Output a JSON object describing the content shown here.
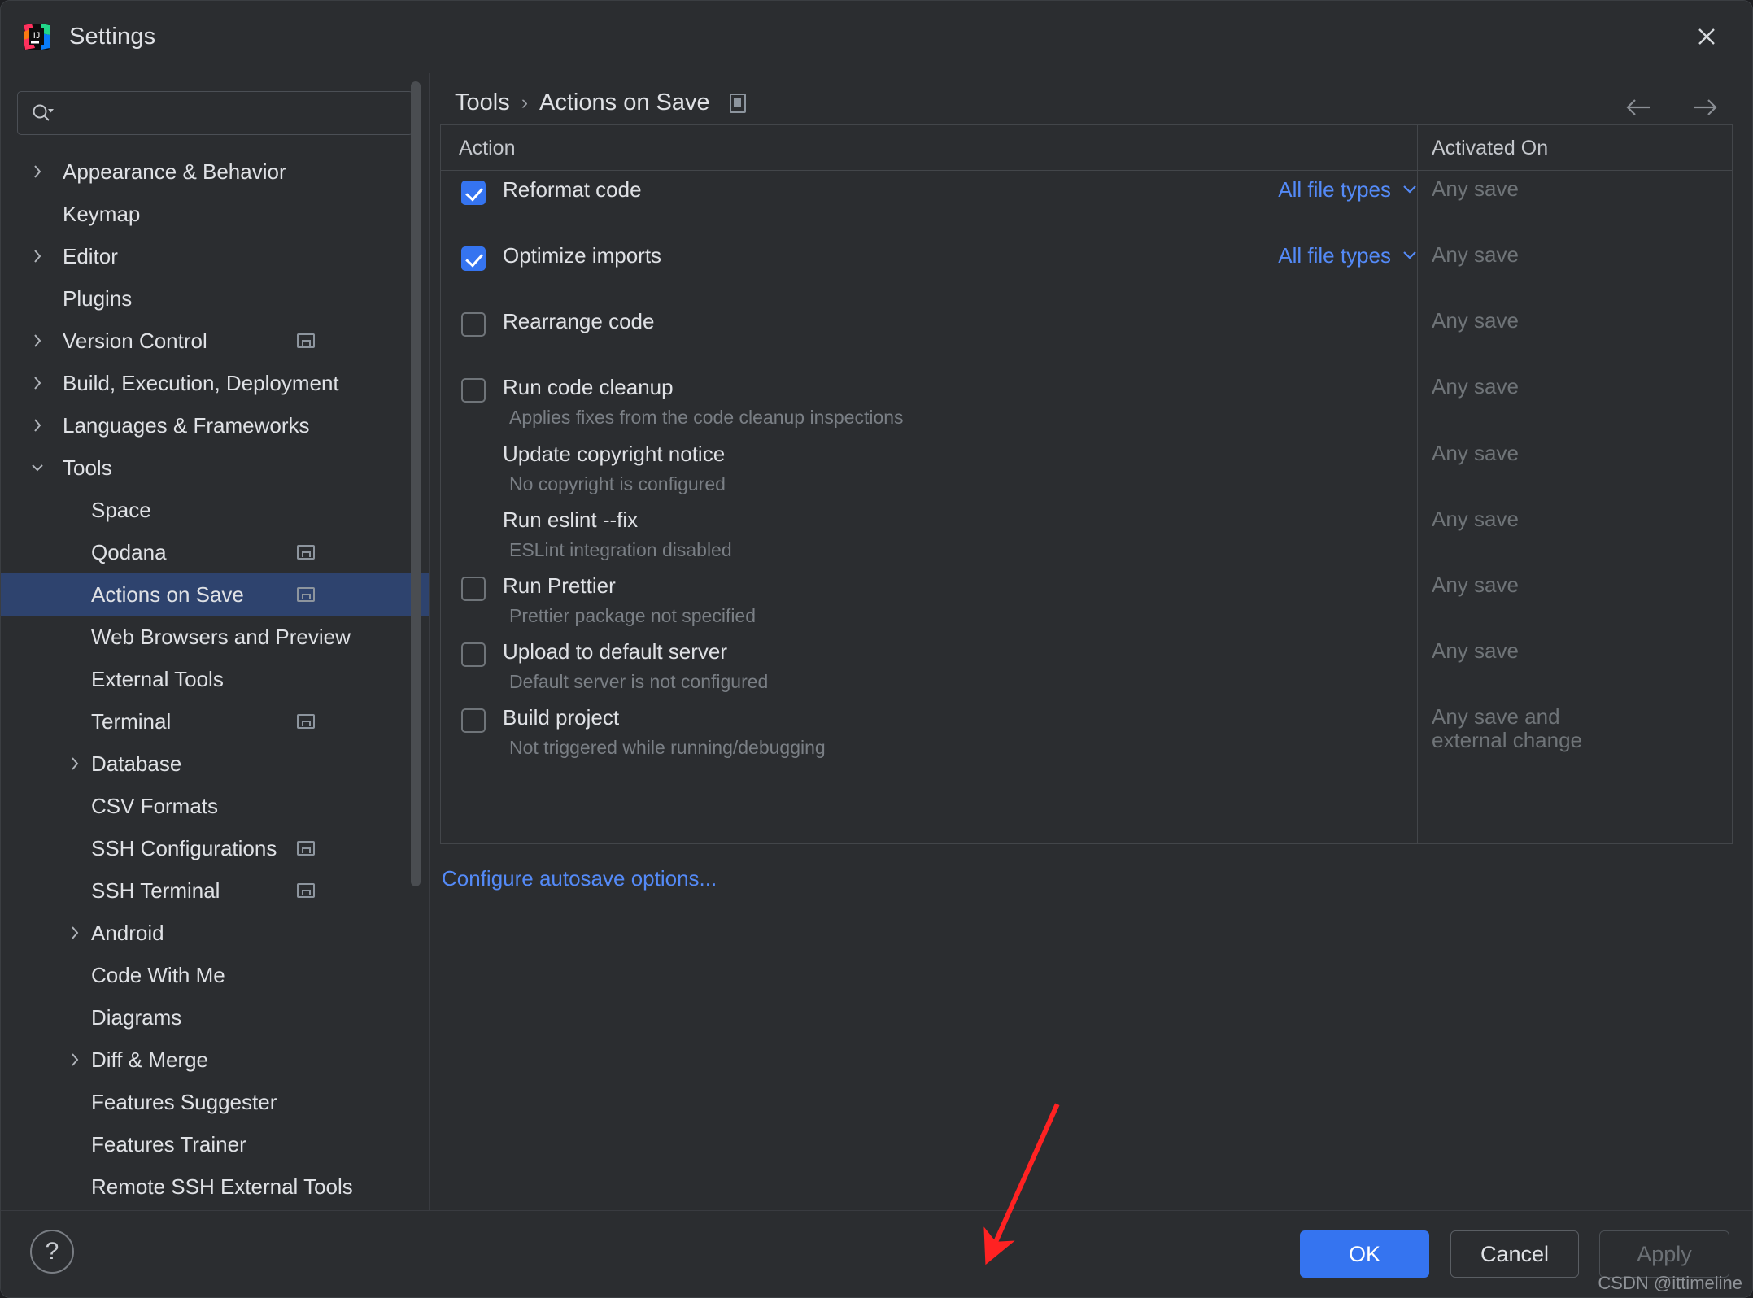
{
  "window": {
    "title": "Settings",
    "app_icon": "intellij-idea-icon",
    "close_icon": "close-icon"
  },
  "sidebar": {
    "search": {
      "placeholder": "",
      "value": "",
      "icon": "search-icon"
    },
    "items": [
      {
        "label": "Appearance & Behavior",
        "depth": 0,
        "twisty": "chevron-right",
        "config": false,
        "selected": false
      },
      {
        "label": "Keymap",
        "depth": 0,
        "twisty": "",
        "config": false,
        "selected": false
      },
      {
        "label": "Editor",
        "depth": 0,
        "twisty": "chevron-right",
        "config": false,
        "selected": false
      },
      {
        "label": "Plugins",
        "depth": 0,
        "twisty": "",
        "config": false,
        "selected": false
      },
      {
        "label": "Version Control",
        "depth": 0,
        "twisty": "chevron-right",
        "config": true,
        "selected": false
      },
      {
        "label": "Build, Execution, Deployment",
        "depth": 0,
        "twisty": "chevron-right",
        "config": false,
        "selected": false
      },
      {
        "label": "Languages & Frameworks",
        "depth": 0,
        "twisty": "chevron-right",
        "config": false,
        "selected": false
      },
      {
        "label": "Tools",
        "depth": 0,
        "twisty": "chevron-down",
        "config": false,
        "selected": false
      },
      {
        "label": "Space",
        "depth": 1,
        "twisty": "",
        "config": false,
        "selected": false
      },
      {
        "label": "Qodana",
        "depth": 1,
        "twisty": "",
        "config": true,
        "selected": false
      },
      {
        "label": "Actions on Save",
        "depth": 1,
        "twisty": "",
        "config": true,
        "selected": true
      },
      {
        "label": "Web Browsers and Preview",
        "depth": 1,
        "twisty": "",
        "config": false,
        "selected": false
      },
      {
        "label": "External Tools",
        "depth": 1,
        "twisty": "",
        "config": false,
        "selected": false
      },
      {
        "label": "Terminal",
        "depth": 1,
        "twisty": "",
        "config": true,
        "selected": false
      },
      {
        "label": "Database",
        "depth": 1,
        "twisty": "chevron-right",
        "config": false,
        "selected": false
      },
      {
        "label": "CSV Formats",
        "depth": 1,
        "twisty": "",
        "config": false,
        "selected": false
      },
      {
        "label": "SSH Configurations",
        "depth": 1,
        "twisty": "",
        "config": true,
        "selected": false
      },
      {
        "label": "SSH Terminal",
        "depth": 1,
        "twisty": "",
        "config": true,
        "selected": false
      },
      {
        "label": "Android",
        "depth": 1,
        "twisty": "chevron-right",
        "config": false,
        "selected": false
      },
      {
        "label": "Code With Me",
        "depth": 1,
        "twisty": "",
        "config": false,
        "selected": false
      },
      {
        "label": "Diagrams",
        "depth": 1,
        "twisty": "",
        "config": false,
        "selected": false
      },
      {
        "label": "Diff & Merge",
        "depth": 1,
        "twisty": "chevron-right",
        "config": false,
        "selected": false
      },
      {
        "label": "Features Suggester",
        "depth": 1,
        "twisty": "",
        "config": false,
        "selected": false
      },
      {
        "label": "Features Trainer",
        "depth": 1,
        "twisty": "",
        "config": false,
        "selected": false
      },
      {
        "label": "Remote SSH External Tools",
        "depth": 1,
        "twisty": "",
        "config": false,
        "selected": false
      }
    ]
  },
  "main": {
    "breadcrumb": {
      "parent": "Tools",
      "separator": "›",
      "current": "Actions on Save",
      "config_icon": "settings-rect-icon"
    },
    "nav": {
      "back_icon": "arrow-left-icon",
      "forward_icon": "arrow-right-icon"
    },
    "table": {
      "headers": {
        "action": "Action",
        "activated_on": "Activated On"
      },
      "rows": [
        {
          "title": "Reformat code",
          "desc": "",
          "checkbox": true,
          "checked": true,
          "scope": "All file types",
          "scope_chevron": "chevron-down-icon",
          "activated": "Any save"
        },
        {
          "title": "Optimize imports",
          "desc": "",
          "checkbox": true,
          "checked": true,
          "scope": "All file types",
          "scope_chevron": "chevron-down-icon",
          "activated": "Any save"
        },
        {
          "title": "Rearrange code",
          "desc": "",
          "checkbox": true,
          "checked": false,
          "scope": "",
          "scope_chevron": "",
          "activated": "Any save"
        },
        {
          "title": "Run code cleanup",
          "desc": "Applies fixes from the code cleanup inspections",
          "checkbox": true,
          "checked": false,
          "scope": "",
          "scope_chevron": "",
          "activated": "Any save"
        },
        {
          "title": "Update copyright notice",
          "desc": "No copyright is configured",
          "checkbox": false,
          "checked": false,
          "scope": "",
          "scope_chevron": "",
          "activated": "Any save"
        },
        {
          "title": "Run eslint --fix",
          "desc": "ESLint integration disabled",
          "checkbox": false,
          "checked": false,
          "scope": "",
          "scope_chevron": "",
          "activated": "Any save"
        },
        {
          "title": "Run Prettier",
          "desc": "Prettier package not specified",
          "checkbox": true,
          "checked": false,
          "scope": "",
          "scope_chevron": "",
          "activated": "Any save"
        },
        {
          "title": "Upload to default server",
          "desc": "Default server is not configured",
          "checkbox": true,
          "checked": false,
          "scope": "",
          "scope_chevron": "",
          "activated": "Any save"
        },
        {
          "title": "Build project",
          "desc": "Not triggered while running/debugging",
          "checkbox": true,
          "checked": false,
          "scope": "",
          "scope_chevron": "",
          "activated": "Any save and\nexternal change"
        }
      ]
    },
    "autosave_link": "Configure autosave options..."
  },
  "footer": {
    "help_icon": "question-mark-icon",
    "help_label": "?",
    "ok_label": "OK",
    "cancel_label": "Cancel",
    "apply_label": "Apply",
    "watermark": "CSDN @ittimeline"
  },
  "colors": {
    "accent": "#3574f0",
    "link": "#548af7",
    "selection": "#2e436e",
    "window_bg": "#2b2d30",
    "annotation_arrow": "#ff2222"
  }
}
